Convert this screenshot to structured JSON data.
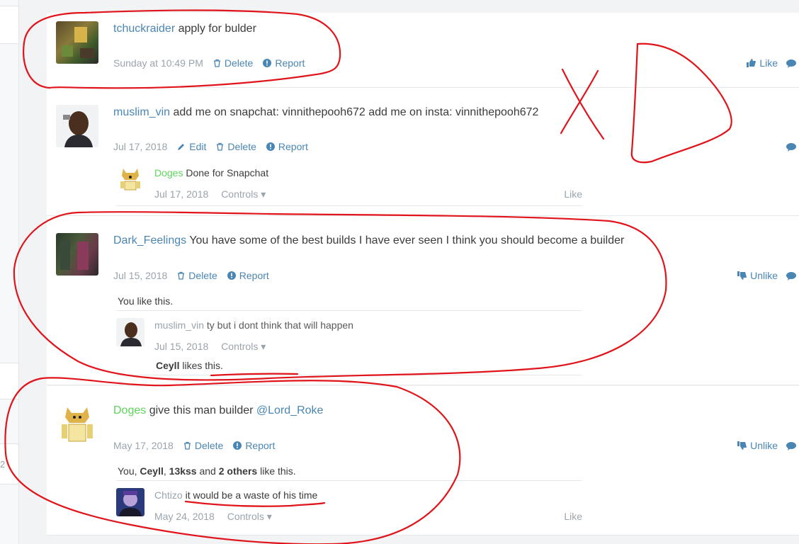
{
  "colors": {
    "link": "#4a86b4",
    "muted": "#9aa4ad",
    "green_user": "#5cd65c",
    "annotation": "#e0141a"
  },
  "side_number": "2",
  "posts": [
    {
      "user": "tchuckraider",
      "text": "apply for bulder",
      "date": "Sunday at 10:49 PM",
      "actions": [
        "Delete",
        "Report"
      ],
      "right_action": "Like"
    },
    {
      "user": "muslim_vin",
      "text": "add me on snapchat: vinnithepooh672 add me on insta: vinnithepooh672",
      "date": "Jul 17, 2018",
      "actions": [
        "Edit",
        "Delete",
        "Report"
      ],
      "comment": {
        "user": "Doges",
        "text": "Done for Snapchat",
        "date": "Jul 17, 2018",
        "controls": "Controls",
        "like": "Like"
      }
    },
    {
      "user": "Dark_Feelings",
      "text": "You have some of the best builds I have ever seen I think you should become a builder",
      "date": "Jul 15, 2018",
      "actions": [
        "Delete",
        "Report"
      ],
      "right_action": "Unlike",
      "likes": "You like this.",
      "comment": {
        "user": "muslim_vin",
        "text": "ty but i dont think that will happen",
        "date": "Jul 15, 2018",
        "controls": "Controls"
      },
      "comment_likes": {
        "name": "Ceyll",
        "suffix": "likes this."
      }
    },
    {
      "user": "Doges",
      "text": "give this man builder",
      "mention": "@Lord_Roke",
      "date": "May 17, 2018",
      "actions": [
        "Delete",
        "Report"
      ],
      "right_action": "Unlike",
      "likes": {
        "p1": "You,",
        "n1": "Ceyll",
        "p2": ",",
        "n2": "13kss",
        "p3": "and",
        "n3": "2 others",
        "p4": "like this."
      },
      "comment": {
        "user": "Chtizo",
        "text": "it would be a waste of his time",
        "date": "May 24, 2018",
        "controls": "Controls",
        "like": "Like"
      }
    }
  ]
}
